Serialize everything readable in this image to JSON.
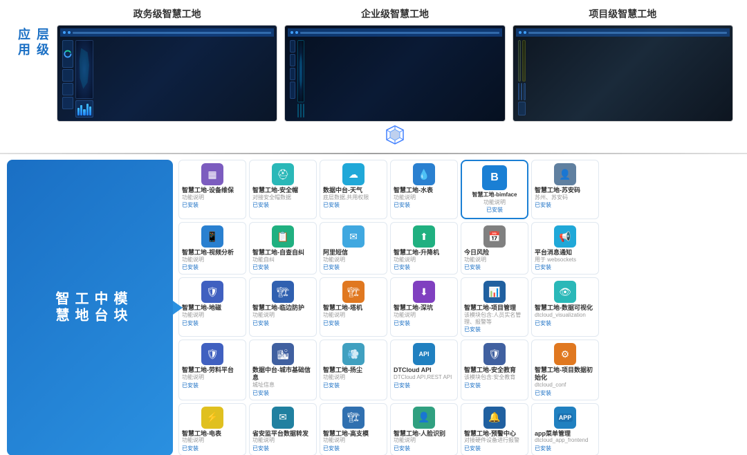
{
  "top": {
    "left_label": [
      "应用",
      "层级"
    ],
    "columns": [
      {
        "title": "政务级智慧工地",
        "id": "gov"
      },
      {
        "title": "企业级智慧工地",
        "id": "enterprise"
      },
      {
        "title": "项目级智慧工地",
        "id": "project"
      }
    ]
  },
  "bottom_label": {
    "lines": [
      "智慧",
      "工地",
      "中台",
      "模块"
    ]
  },
  "modules": [
    {
      "id": "m1",
      "icon_color": "icon-purple",
      "icon_char": "▦",
      "name": "智慧工地-设备维保",
      "desc": "功能说明",
      "status": "已安装"
    },
    {
      "id": "m2",
      "icon_color": "icon-teal",
      "icon_char": "⛑",
      "name": "智慧工地-安全帽",
      "desc": "对接安全帽数据",
      "status": "已安装"
    },
    {
      "id": "m3",
      "icon_color": "icon-cyan",
      "icon_char": "☁",
      "name": "数据中台-天气",
      "desc": "底层数据,共用权限",
      "status": "已安装"
    },
    {
      "id": "m4",
      "icon_color": "icon-blue",
      "icon_char": "💧",
      "name": "智慧工地-水表",
      "desc": "功能说明",
      "status": "已安装"
    },
    {
      "id": "m5",
      "icon_color": "icon-bimface",
      "icon_char": "B",
      "name": "智慧工地-bimface",
      "desc": "功能说明",
      "status": "已安装"
    },
    {
      "id": "m6",
      "icon_color": "icon-sky",
      "icon_char": "👤",
      "name": "智慧工地-苏安码",
      "desc": "苏州、苏安码",
      "status": "已安装"
    },
    {
      "id": "m7",
      "icon_color": "icon-blue",
      "icon_char": "📱",
      "name": "智慧工地-视频分析",
      "desc": "功能说明",
      "status": "已安装"
    },
    {
      "id": "m8",
      "icon_color": "icon-emerald",
      "icon_char": "📋",
      "name": "智慧工地-自查自纠",
      "desc": "功能自纠",
      "status": "已安装"
    },
    {
      "id": "m9",
      "icon_color": "icon-sky",
      "icon_char": "✉",
      "name": "阿里短信",
      "desc": "功能说明",
      "status": "已安装"
    },
    {
      "id": "m10",
      "icon_color": "icon-emerald",
      "icon_char": "⬆",
      "name": "智慧工地-升降机",
      "desc": "功能说明",
      "status": "已安装"
    },
    {
      "id": "m11",
      "icon_color": "icon-gray",
      "icon_char": "🗓",
      "name": "今日风险",
      "desc": "功能说明",
      "status": "已安装"
    },
    {
      "id": "m12",
      "icon_color": "icon-cyan",
      "icon_char": "📢",
      "name": "平台消息通知",
      "desc": "用于 websockets",
      "status": "已安装"
    },
    {
      "id": "m13",
      "icon_color": "icon-indigo",
      "icon_char": "🛡",
      "name": "智慧工地-地磁",
      "desc": "功能说明",
      "status": "已安装"
    },
    {
      "id": "m14",
      "icon_color": "icon-blue",
      "icon_char": "🏗",
      "name": "智慧工地-临边防护",
      "desc": "功能说明",
      "status": "已安装"
    },
    {
      "id": "m15",
      "icon_color": "icon-orange",
      "icon_char": "🏗",
      "name": "智慧工地-塔机",
      "desc": "功能说明",
      "status": "已安装"
    },
    {
      "id": "m16",
      "icon_color": "icon-violet",
      "icon_char": "🔩",
      "name": "智慧工地-深坑",
      "desc": "功能说明",
      "status": "已安装"
    },
    {
      "id": "m17",
      "icon_color": "icon-blue",
      "icon_char": "📊",
      "name": "智慧工地-项目管理",
      "desc": "该模块包含:人员实名管理、报警等",
      "status": "已安装"
    },
    {
      "id": "m18",
      "icon_color": "icon-teal",
      "icon_char": "📊",
      "name": "智慧工地-数据可视化",
      "desc": "dtcloud_visualization",
      "status": "已安装"
    },
    {
      "id": "m19",
      "icon_color": "icon-indigo",
      "icon_char": "🛡",
      "name": "智慧工地-劳料平台",
      "desc": "功能说明",
      "status": "已安装"
    },
    {
      "id": "m20",
      "icon_color": "icon-blue",
      "icon_char": "🏙",
      "name": "数据中台-城市基础信息",
      "desc": "城址信息",
      "status": "已安装"
    },
    {
      "id": "m21",
      "icon_color": "icon-sky",
      "icon_char": "💨",
      "name": "智慧工地-扬尘",
      "desc": "功能说明",
      "status": "已安装"
    },
    {
      "id": "m22",
      "icon_color": "icon-sky",
      "icon_char": "API",
      "name": "DTCloud API",
      "desc": "DTCloud API,REST API",
      "status": "已安装"
    },
    {
      "id": "m23",
      "icon_color": "icon-indigo",
      "icon_char": "🛡",
      "name": "智慧工地-安全教育",
      "desc": "该模块包含:安全教育",
      "status": "已安装"
    },
    {
      "id": "m24",
      "icon_color": "icon-orange",
      "icon_char": "⚙",
      "name": "智慧工地-项目数据初始化",
      "desc": "dtcloud_conf",
      "status": "已安装"
    },
    {
      "id": "m25",
      "icon_color": "icon-emerald",
      "icon_char": "⚡",
      "name": "智慧工地-电表",
      "desc": "功能说明",
      "status": "已安装"
    },
    {
      "id": "m26",
      "icon_color": "icon-sky",
      "icon_char": "✉",
      "name": "省安监平台数据转发",
      "desc": "功能说明",
      "status": "已安装"
    },
    {
      "id": "m27",
      "icon_color": "icon-blue",
      "icon_char": "🏗",
      "name": "智慧工地-高支模",
      "desc": "功能说明",
      "status": "已安装"
    },
    {
      "id": "m28",
      "icon_color": "icon-teal",
      "icon_char": "👤",
      "name": "智慧工地-人脸识别",
      "desc": "功能说明",
      "status": "已安装"
    },
    {
      "id": "m29",
      "icon_color": "icon-blue",
      "icon_char": "🔔",
      "name": "智慧工地-预警中心",
      "desc": "对接硬件设备进行报警",
      "status": "已安装"
    },
    {
      "id": "m30",
      "icon_color": "icon-sky",
      "icon_char": "APP",
      "name": "app菜单管理",
      "desc": "dtcloud_app_frontend",
      "status": "已安装"
    }
  ]
}
